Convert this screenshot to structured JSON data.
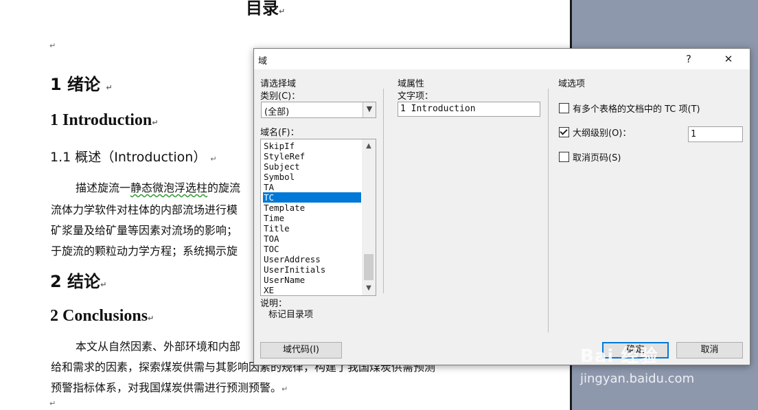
{
  "document": {
    "top_title": "目录",
    "heading1_cn": "1  绪论",
    "heading1_en": "1 Introduction",
    "subheading": "1.1  概述（Introduction）",
    "para1_line1_a": "描述旋流一",
    "para1_line1_b": "静态微泡浮选柱",
    "para1_line1_c": "的旋流",
    "para1_line2": "流体力学软件对柱体的内部流场进行模",
    "para1_line3": "矿浆量及给矿量等因素对流场的影响；",
    "para1_line4": "于旋流的颗粒动力学方程；系统揭示旋",
    "heading2_cn": "2  结论",
    "heading2_en": "2 Conclusions",
    "para2_line1": "本文从自然因素、外部环境和内部",
    "para2_line2": "给和需求的因素，探索煤炭供需与其影响因素的规律，构建了我国煤炭供需预测",
    "para2_line3": "预警指标体系，对我国煤炭供需进行预测预警。"
  },
  "dialog": {
    "title": "域",
    "help_icon": "?",
    "close_icon": "✕",
    "left_group_title": "请选择域",
    "category_label": "类别(C)：",
    "category_value": "(全部)",
    "fieldname_label": "域名(F)：",
    "field_list": [
      "SkipIf",
      "StyleRef",
      "Subject",
      "Symbol",
      "TA",
      "TC",
      "Template",
      "Time",
      "Title",
      "TOA",
      "TOC",
      "UserAddress",
      "UserInitials",
      "UserName",
      "XE"
    ],
    "selected_field": "TC",
    "desc_label": "说明：",
    "desc_text": "标记目录项",
    "props_title": "域属性",
    "text_item_label": "文字项：",
    "text_item_value": "1 Introduction",
    "options_title": "域选项",
    "opt1_label": "有多个表格的文档中的 TC 项(T)",
    "opt1_checked": false,
    "opt2_label": "大纲级别(O)：",
    "opt2_checked": true,
    "opt2_value": "1",
    "opt3_label": "取消页码(S)",
    "opt3_checked": false,
    "field_codes_button": "域代码(I)",
    "ok_button": "确定",
    "cancel_button": "取消"
  },
  "watermark": {
    "brand": "Bai 经验",
    "url": "jingyan.baidu.com"
  },
  "colors": {
    "selection": "#0078d7",
    "side_pane": "#8e98ad",
    "dialog_bg": "#f0f0f0"
  }
}
